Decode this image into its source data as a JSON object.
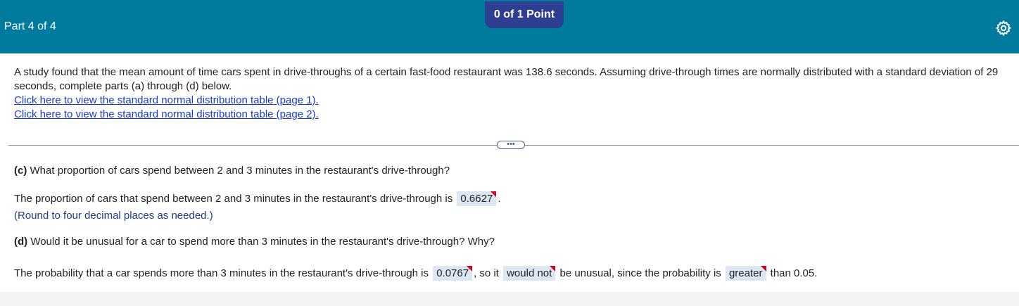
{
  "header": {
    "part_label": "Part 4 of 4",
    "points_label": "0 of 1 Point",
    "settings_icon": "gear-icon",
    "bar_color": "#007b9e",
    "badge_color": "#2e3f91"
  },
  "intro": {
    "text": "A study found that the mean amount of time cars spent in drive-throughs of a certain fast-food restaurant was 138.6 seconds. Assuming drive-through times are normally distributed with a standard deviation of 29 seconds, complete parts (a) through (d) below.",
    "link1": "Click here to view the standard normal distribution table (page 1).",
    "link2": "Click here to view the standard normal distribution table (page 2)."
  },
  "expand_button": "•••",
  "part_c": {
    "label": "(c)",
    "question": " What proportion of cars spend between 2 and 3 minutes in the restaurant's drive-through?",
    "answer_prefix": "The proportion of cars that spend between 2 and 3 minutes in the restaurant's drive-through is ",
    "answer_value": "0.6627",
    "answer_suffix": ".",
    "hint": "(Round to four decimal places as needed.)"
  },
  "part_d": {
    "label": "(d)",
    "question": " Would it be unusual for a car to spend more than 3 minutes in the restaurant's drive-through? Why?",
    "text1": "The probability that a car spends more than 3 minutes in the restaurant's drive-through is ",
    "value1": "0.0767",
    "text2": ", so it ",
    "value2": "would not",
    "text3": " be unusual, since the probability is ",
    "value3": "greater",
    "text4": " than 0.05."
  }
}
